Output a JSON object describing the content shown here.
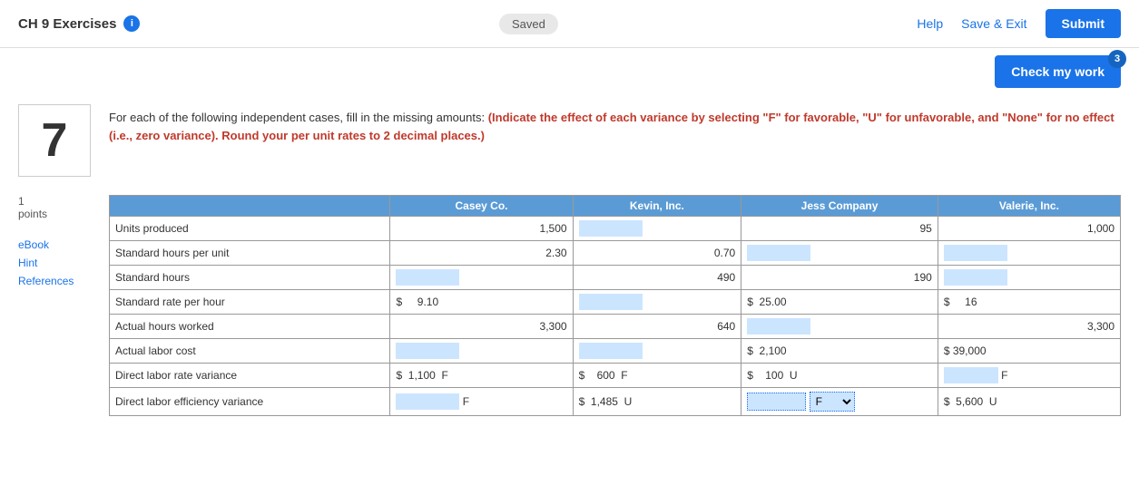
{
  "header": {
    "title": "CH 9 Exercises",
    "info_icon": "i",
    "saved_label": "Saved",
    "help_label": "Help",
    "save_exit_label": "Save & Exit",
    "submit_label": "Submit"
  },
  "check_work": {
    "label": "Check my work",
    "badge": "3"
  },
  "question": {
    "number": "7",
    "points": "1",
    "points_label": "points",
    "text_plain": "For each of the following independent cases, fill in the missing amounts: ",
    "text_highlight": "(Indicate the effect of each variance by selecting \"F\" for favorable, \"U\" for unfavorable, and \"None\" for no effect (i.e., zero variance). Round your per unit rates to 2 decimal places.)"
  },
  "sidebar": {
    "ebook_label": "eBook",
    "hint_label": "Hint",
    "references_label": "References"
  },
  "table": {
    "columns": [
      "",
      "Casey Co.",
      "Kevin, Inc.",
      "Jess Company",
      "Valerie, Inc."
    ],
    "rows": [
      {
        "label": "Units produced",
        "casey_value": "1,500",
        "casey_input": false,
        "kevin_input": true,
        "kevin_value": "",
        "jess_value": "95",
        "jess_input": false,
        "valerie_value": "1,000",
        "valerie_input": false
      },
      {
        "label": "Standard hours per unit",
        "casey_value": "2.30",
        "casey_input": false,
        "kevin_input": false,
        "kevin_value": "0.70",
        "jess_input": true,
        "jess_value": "",
        "valerie_input": true,
        "valerie_value": ""
      },
      {
        "label": "Standard hours",
        "casey_input": true,
        "casey_value": "",
        "kevin_input": false,
        "kevin_value": "490",
        "jess_input": false,
        "jess_value": "190",
        "valerie_input": true,
        "valerie_value": ""
      },
      {
        "label": "Standard rate per hour",
        "casey_dollar": true,
        "casey_value": "9.10",
        "casey_input": false,
        "kevin_input": true,
        "kevin_value": "",
        "jess_dollar": true,
        "jess_value": "25.00",
        "jess_input": false,
        "valerie_dollar": true,
        "valerie_value": "16",
        "valerie_input": false
      },
      {
        "label": "Actual hours worked",
        "casey_value": "3,300",
        "casey_input": false,
        "kevin_input": false,
        "kevin_value": "640",
        "jess_input": true,
        "jess_value": "",
        "valerie_input": false,
        "valerie_value": "3,300"
      },
      {
        "label": "Actual labor cost",
        "casey_input": true,
        "casey_value": "",
        "kevin_input": true,
        "kevin_value": "",
        "jess_dollar": true,
        "jess_value": "2,100",
        "jess_input": false,
        "valerie_dollar": true,
        "valerie_value": "39,000",
        "valerie_input": false
      },
      {
        "label": "Direct labor rate variance",
        "casey_dollar": true,
        "casey_value": "1,100",
        "casey_variance": "F",
        "kevin_dollar": true,
        "kevin_value": "600",
        "kevin_variance": "F",
        "jess_dollar": true,
        "jess_value": "100",
        "jess_variance": "U",
        "valerie_input": true,
        "valerie_variance": "F"
      },
      {
        "label": "Direct labor efficiency variance",
        "casey_input": true,
        "casey_variance": "F",
        "kevin_dollar": true,
        "kevin_value": "1,485",
        "kevin_variance": "U",
        "jess_input_dotted": true,
        "jess_variance_dotted": "F",
        "valerie_dollar": true,
        "valerie_value": "5,600",
        "valerie_variance": "U"
      }
    ]
  }
}
